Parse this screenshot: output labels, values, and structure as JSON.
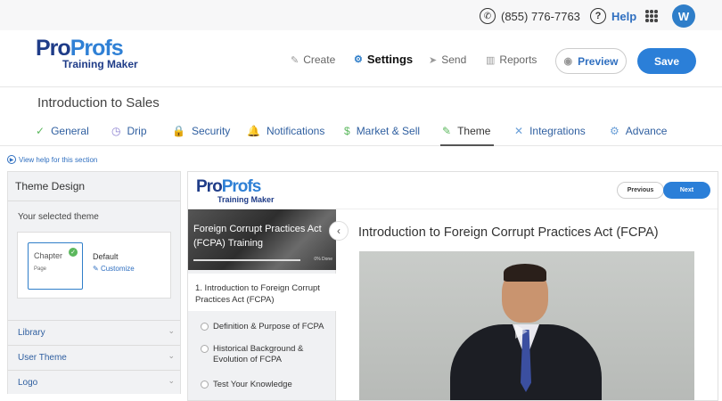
{
  "topbar": {
    "phone": "(855) 776-7763",
    "help": "Help",
    "avatar_initial": "W"
  },
  "header": {
    "logo_pro": "Pro",
    "logo_profs": "Profs",
    "logo_sub": "Training Maker",
    "nav": {
      "create": "Create",
      "settings": "Settings",
      "send": "Send",
      "reports": "Reports"
    },
    "preview_label": "Preview",
    "save_label": "Save"
  },
  "course_title": "Introduction to Sales",
  "tabs": [
    {
      "label": "General",
      "icon": "check-circle-icon"
    },
    {
      "label": "Drip",
      "icon": "clock-icon"
    },
    {
      "label": "Security",
      "icon": "lock-icon"
    },
    {
      "label": "Notifications",
      "icon": "bell-icon"
    },
    {
      "label": "Market & Sell",
      "icon": "dollar-icon"
    },
    {
      "label": "Theme",
      "icon": "brush-icon",
      "active": true
    },
    {
      "label": "Integrations",
      "icon": "tools-icon"
    },
    {
      "label": "Advance",
      "icon": "gears-icon"
    }
  ],
  "help_link": "View help for this section",
  "left_panel": {
    "header": "Theme Design",
    "selected_label": "Your selected theme",
    "thumb_chapter": "Chapter",
    "thumb_page": "Page",
    "theme_name": "Default",
    "customize": "Customize",
    "sections": [
      "Library",
      "User Theme",
      "Logo"
    ]
  },
  "preview": {
    "logo_pro": "Pro",
    "logo_profs": "Profs",
    "logo_sub": "Training Maker",
    "prev_label": "Previous",
    "next_label": "Next",
    "cover_title": "Foreign Corrupt Practices Act (FCPA) Training",
    "progress_text": "0% Done",
    "progress": 0,
    "chapter": "1. Introduction to Foreign Corrupt Practices Act (FCPA)",
    "items": [
      "Definition & Purpose of FCPA",
      "Historical Background & Evolution of FCPA",
      "Test Your Knowledge"
    ],
    "content_title": "Introduction to Foreign Corrupt Practices Act (FCPA)"
  },
  "colors": {
    "accent": "#2b7fd8",
    "brand_dark": "#1f3c88",
    "brand_light": "#2f80d5",
    "success": "#5bb85d"
  }
}
